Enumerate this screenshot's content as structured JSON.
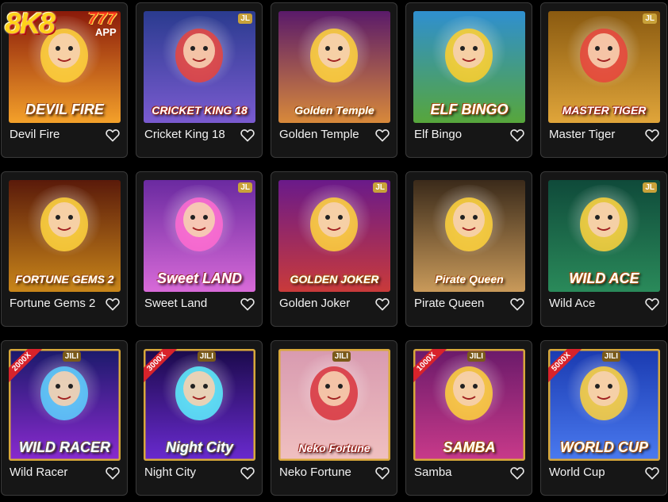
{
  "brand": {
    "logo_main": "8K8",
    "logo_sevens": "777",
    "logo_sub": "APP"
  },
  "games": [
    {
      "name": "Devil Fire",
      "art": "DEVIL FIRE",
      "bg1": "#8a1a0a",
      "bg2": "#f4a12a",
      "accent": "#ffd23a",
      "badge": ""
    },
    {
      "name": "Cricket King 18",
      "art": "CRICKET KING 18",
      "bg1": "#2a3b8f",
      "bg2": "#7a5bd0",
      "accent": "#e8433b",
      "badge": "JL"
    },
    {
      "name": "Golden Temple",
      "art": "Golden Temple",
      "bg1": "#5a1a6a",
      "bg2": "#d8893a",
      "accent": "#ffd23a",
      "badge": ""
    },
    {
      "name": "Elf Bingo",
      "art": "ELF BINGO",
      "bg1": "#2f8fd0",
      "bg2": "#57a63b",
      "accent": "#ffcf2a",
      "badge": ""
    },
    {
      "name": "Master Tiger",
      "art": "MASTER TIGER",
      "bg1": "#8a5a10",
      "bg2": "#e0a53a",
      "accent": "#e8433b",
      "badge": "JL"
    },
    {
      "name": "Fortune Gems 2",
      "art": "FORTUNE GEMS 2",
      "bg1": "#5a1a0a",
      "bg2": "#c9861a",
      "accent": "#ffd23a",
      "badge": ""
    },
    {
      "name": "Sweet Land",
      "art": "Sweet LAND",
      "bg1": "#6a2aa0",
      "bg2": "#d86ad8",
      "accent": "#ff6ad0",
      "badge": "JL"
    },
    {
      "name": "Golden Joker",
      "art": "GOLDEN JOKER",
      "bg1": "#6a1a8a",
      "bg2": "#c93a3a",
      "accent": "#ffd23a",
      "badge": "JL"
    },
    {
      "name": "Pirate Queen",
      "art": "Pirate Queen",
      "bg1": "#3a2a1a",
      "bg2": "#c99a5a",
      "accent": "#ffd23a",
      "badge": ""
    },
    {
      "name": "Wild Ace",
      "art": "WILD ACE",
      "bg1": "#0f4a3a",
      "bg2": "#2a8a5a",
      "accent": "#ffd23a",
      "badge": "JL"
    },
    {
      "name": "Wild Racer",
      "art": "WILD RACER",
      "bg1": "#1a1a6a",
      "bg2": "#8a2ad0",
      "accent": "#5ad0ff",
      "badge": "JILI",
      "ribbon": "2000X"
    },
    {
      "name": "Night City",
      "art": "Night City",
      "bg1": "#1a0a4a",
      "bg2": "#6a2ad0",
      "accent": "#5af0ff",
      "badge": "JILI",
      "ribbon": "3000X"
    },
    {
      "name": "Neko Fortune",
      "art": "Neko Fortune",
      "bg1": "#d89ab0",
      "bg2": "#f0c0c0",
      "accent": "#d8333b",
      "badge": "JILI",
      "ribbon": ""
    },
    {
      "name": "Samba",
      "art": "SAMBA",
      "bg1": "#6a1a6a",
      "bg2": "#c93a8a",
      "accent": "#ffd23a",
      "badge": "JILI",
      "ribbon": "1000X"
    },
    {
      "name": "World Cup",
      "art": "WORLD CUP",
      "bg1": "#1a3ab0",
      "bg2": "#4a7af0",
      "accent": "#ffd23a",
      "badge": "JILI",
      "ribbon": "5000X"
    }
  ]
}
